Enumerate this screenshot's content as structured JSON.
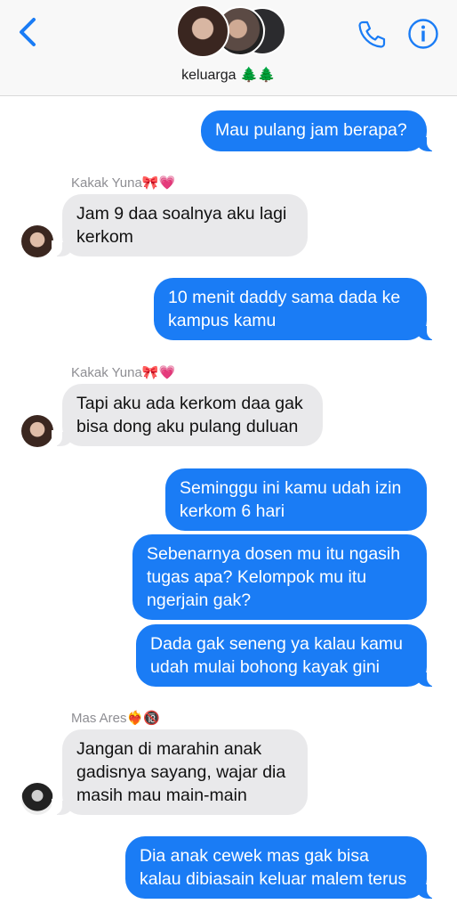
{
  "header": {
    "group_name": "keluarga 🌲🌲",
    "avatars": [
      "avatar-yuna",
      "avatar-member-2",
      "avatar-member-3"
    ],
    "icons": {
      "back": "chevron-left-icon",
      "call": "phone-icon",
      "info": "info-icon"
    },
    "accent_color": "#1a7cf5"
  },
  "messages": [
    {
      "type": "outgoing",
      "text": "Mau pulang jam berapa?"
    },
    {
      "type": "incoming",
      "sender": "Kakak Yuna🎀💗",
      "text": "Jam 9 daa soalnya aku lagi\nkerkom"
    },
    {
      "type": "outgoing",
      "text": "10 menit daddy sama dada ke\nkampus kamu"
    },
    {
      "type": "incoming",
      "sender": "Kakak Yuna🎀💗",
      "text": "Tapi aku ada kerkom daa gak\nbisa dong aku pulang duluan"
    },
    {
      "type": "outgoing",
      "text": "Seminggu ini kamu udah izin\nkerkom 6 hari"
    },
    {
      "type": "outgoing",
      "text": "Sebenarnya dosen mu itu ngasih\ntugas apa? Kelompok mu itu\nngerjain gak?"
    },
    {
      "type": "outgoing",
      "text": "Dada gak seneng ya kalau kamu\nudah mulai bohong kayak gini"
    },
    {
      "type": "incoming",
      "sender": "Mas Ares❤️‍🔥🔞",
      "text": "Jangan di marahin anak\ngadisnya sayang, wajar dia\nmasih mau main-main"
    },
    {
      "type": "outgoing",
      "text": "Dia anak cewek mas gak bisa\nkalau dibiasain keluar malem terus"
    }
  ]
}
